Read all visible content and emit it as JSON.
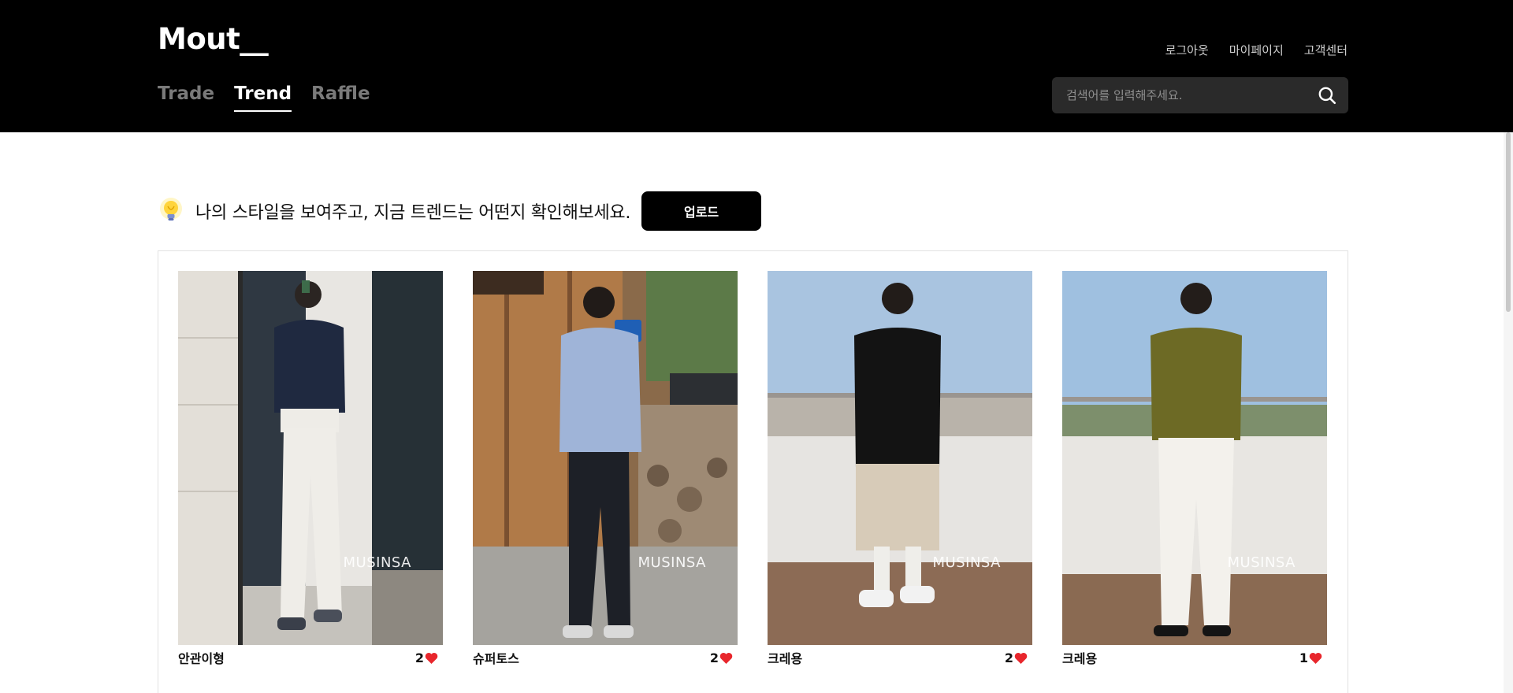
{
  "header": {
    "logo": "Mout__",
    "util_links": [
      "로그아웃",
      "마이페이지",
      "고객센터"
    ],
    "tabs": [
      {
        "label": "Trade",
        "active": false
      },
      {
        "label": "Trend",
        "active": true
      },
      {
        "label": "Raffle",
        "active": false
      }
    ],
    "search": {
      "placeholder": "검색어를 입력해주세요.",
      "value": "",
      "icon": "search-icon"
    }
  },
  "intro": {
    "icon": "lightbulb-icon",
    "text": "나의 스타일을 보여주고, 지금 트렌드는 어떤지 확인해보세요.",
    "upload_label": "업로드"
  },
  "posts": [
    {
      "author": "안관이형",
      "likes": "2",
      "watermark": "MUSINSA",
      "heart_color": "#e8262c"
    },
    {
      "author": "슈퍼토스",
      "likes": "2",
      "watermark": "MUSINSA",
      "heart_color": "#e8262c"
    },
    {
      "author": "크레용",
      "likes": "2",
      "watermark": "MUSINSA",
      "heart_color": "#e8262c"
    },
    {
      "author": "크레용",
      "likes": "1",
      "watermark": "MUSINSA",
      "heart_color": "#e8262c"
    }
  ],
  "colors": {
    "header_bg": "#000000",
    "accent": "#000000",
    "heart": "#e8262c"
  }
}
